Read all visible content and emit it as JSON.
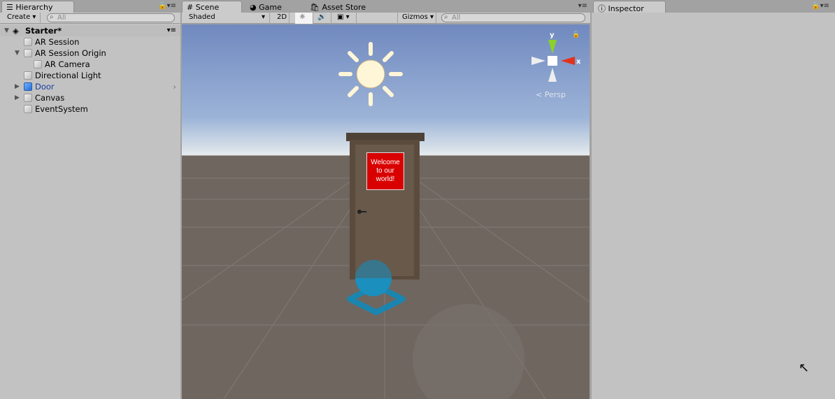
{
  "hierarchy": {
    "tab": "Hierarchy",
    "create": "Create",
    "search_placeholder": "All",
    "scene": "Starter*",
    "items": [
      {
        "label": "AR Session"
      },
      {
        "label": "AR Session Origin"
      },
      {
        "label": "AR Camera"
      },
      {
        "label": "Directional Light"
      },
      {
        "label": "Door"
      },
      {
        "label": "Canvas"
      },
      {
        "label": "EventSystem"
      }
    ]
  },
  "scene": {
    "tabs": [
      "Scene",
      "Game",
      "Asset Store"
    ],
    "shading": "Shaded",
    "mode2d": "2D",
    "gizmos": "Gizmos",
    "search_placeholder": "All",
    "gizmo": {
      "y": "y",
      "x": "x",
      "projection": "Persp"
    },
    "sign": [
      "Welcome",
      "to our",
      "world!"
    ]
  },
  "inspector": {
    "tab": "Inspector"
  },
  "colors": {
    "sign": "#d90000",
    "selected_text": "#1a3ea0"
  }
}
